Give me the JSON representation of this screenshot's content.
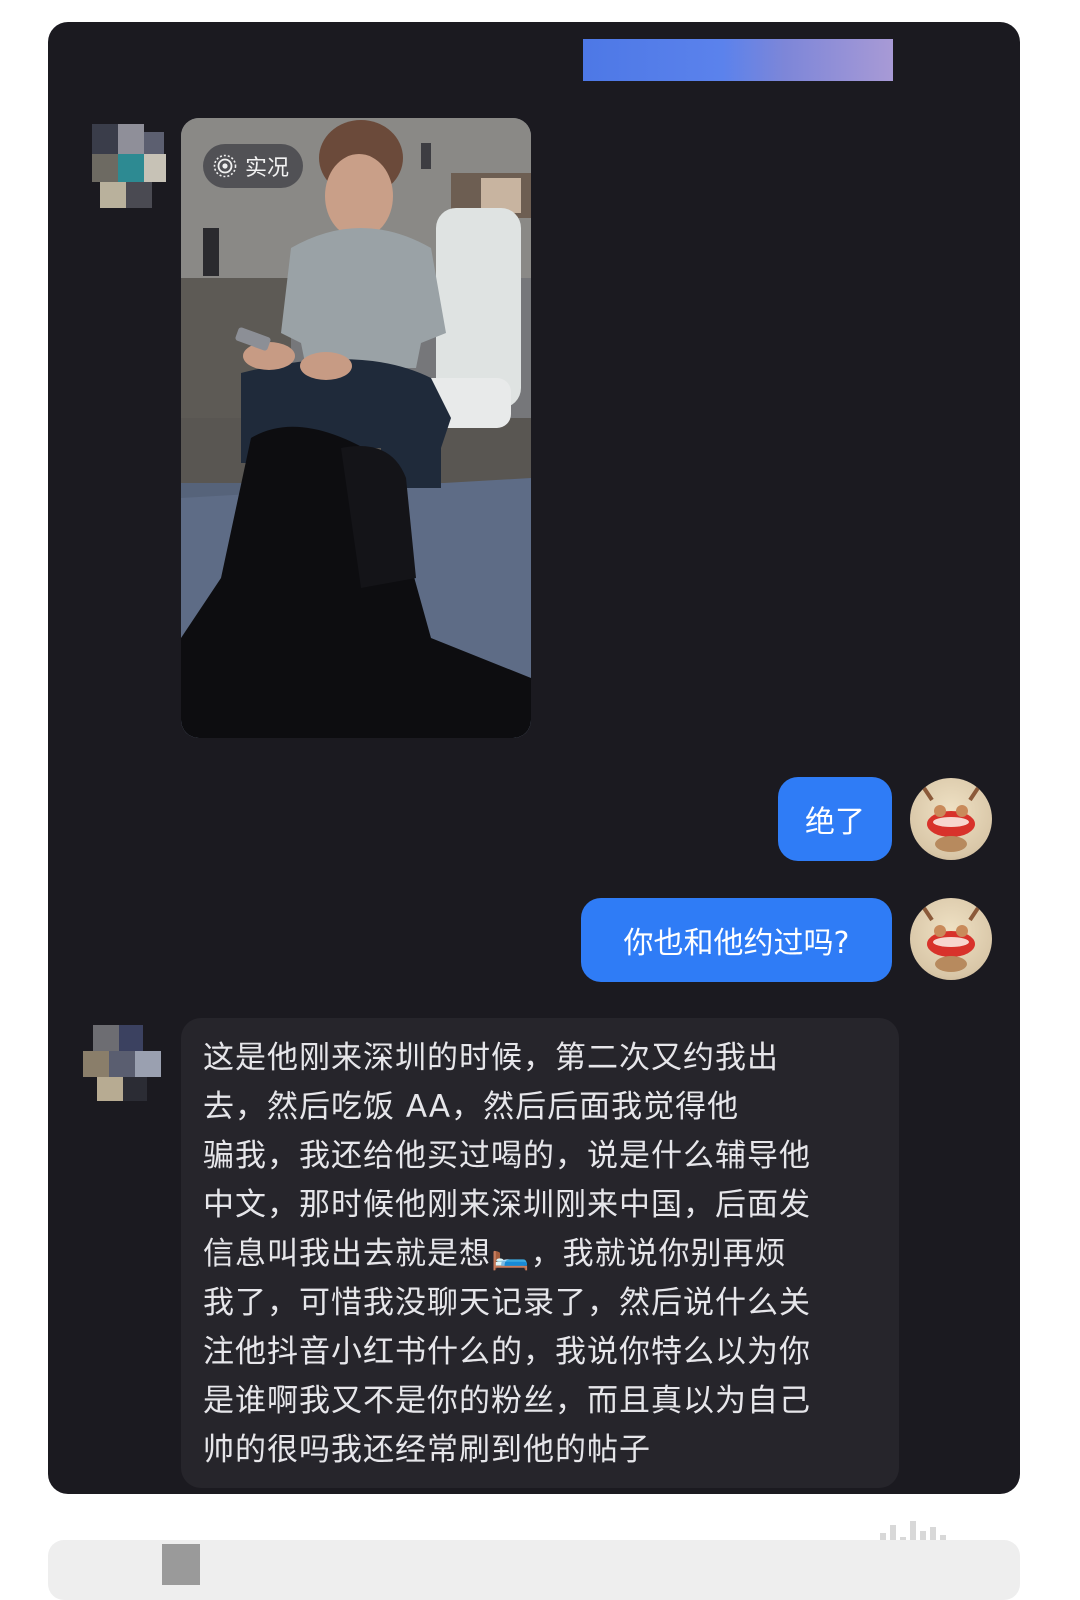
{
  "chat": {
    "live_badge": "实况",
    "bubble_1": "绝了",
    "bubble_2": "你也和他约过吗?",
    "reply_lines": [
      "这是他刚来深圳的时候，第二次又约我出",
      "去，然后吃饭 AA，然后后面我觉得他",
      "骗我，我还给他买过喝的，说是什么辅导他",
      "中文，那时候他刚来深圳刚来中国，后面发",
      "信息叫我出去就是想🛏️，我就说你别再烦",
      "我了，可惜我没聊天记录了，然后说什么关",
      "注他抖音小红书什么的，我说你特么以为你",
      "是谁啊我又不是你的粉丝，而且真以为自己",
      "帅的很吗我还经常刷到他的帖子"
    ]
  },
  "colors": {
    "background": "#1b1a20",
    "bubble_out": "#2f7cf6",
    "bubble_in": "#26252b"
  }
}
